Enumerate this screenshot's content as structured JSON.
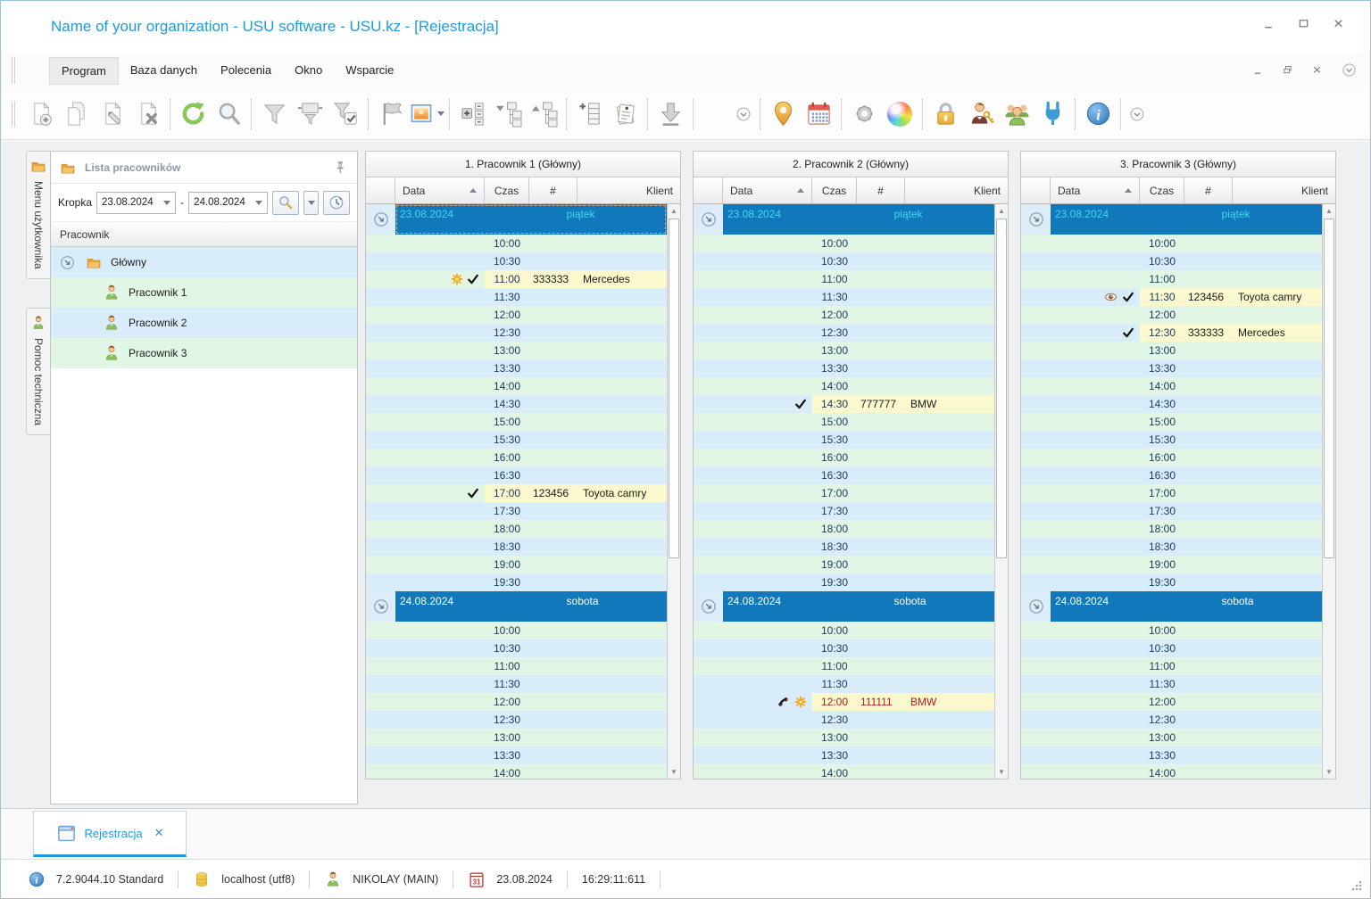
{
  "window": {
    "title": "Name of your organization - USU software - USU.kz - [Rejestracja]",
    "controls": [
      "minimize",
      "maximize",
      "close"
    ]
  },
  "menu": {
    "items": [
      "Program",
      "Baza danych",
      "Polecenia",
      "Okno",
      "Wsparcie"
    ],
    "active": "Program",
    "right_controls": [
      "minimize",
      "restore",
      "close",
      "collapse-ribbon"
    ]
  },
  "toolbar": {
    "groups": [
      {
        "items": [
          "doc-new-icon",
          "doc-copy-icon",
          "doc-edit-icon",
          "doc-delete-icon"
        ]
      },
      {
        "items": [
          "refresh-icon",
          "search-icon"
        ]
      },
      {
        "items": [
          "filter-icon",
          "filter-panel-icon",
          "filter-check-icon"
        ]
      },
      {
        "items": [
          "flag-icon",
          "image-icon"
        ]
      },
      {
        "items": [
          "expand-all-icon",
          "tree-collapse-icon",
          "tree-expand-icon"
        ]
      },
      {
        "items": [
          "table-add-icon",
          "notes-icon"
        ]
      },
      {
        "items": [
          "download-icon"
        ]
      },
      {
        "items": [
          "overflow-icon"
        ],
        "small": true,
        "gap": 38
      },
      {
        "items": [
          "location-icon",
          "calendar-icon"
        ]
      },
      {
        "items": [
          "gear-icon",
          "colors-icon"
        ]
      },
      {
        "items": [
          "lock-icon",
          "user-key-icon",
          "users-icon",
          "plug-icon"
        ]
      },
      {
        "items": [
          "info-icon"
        ]
      },
      {
        "items": [
          "overflow-icon"
        ],
        "small": true,
        "nosep": true
      }
    ]
  },
  "sidebar": {
    "tabs": [
      {
        "label": "Menu użytkownika",
        "icon": "folder-open-icon"
      },
      {
        "label": "Pomoc techniczna",
        "icon": "employee-icon"
      }
    ],
    "panel_title": "Lista pracowników",
    "panel_icons": [
      "folder-open-icon",
      "pin-icon"
    ],
    "filter": {
      "label": "Kropka",
      "date_from": "23.08.2024",
      "date_to": "24.08.2024",
      "dash": "-",
      "buttons": [
        "magnifier-gold-icon",
        "dropdown-caret",
        "clock-icon"
      ]
    },
    "tree_header": "Pracownik",
    "tree": {
      "root": {
        "label": "Główny",
        "icons": [
          "expand-arrow-icon",
          "folder-open-icon"
        ]
      },
      "children": [
        {
          "label": "Pracownik 1",
          "icon": "employee-icon"
        },
        {
          "label": "Pracownik 2",
          "icon": "employee-icon"
        },
        {
          "label": "Pracownik 3",
          "icon": "employee-icon"
        }
      ]
    }
  },
  "calendar": {
    "headers": {
      "data": "Data",
      "czas": "Czas",
      "num": "#",
      "klient": "Klient"
    },
    "columns": [
      {
        "title": "1. Pracownik 1 (Główny)",
        "days": [
          {
            "date": "23.08.2024",
            "weekday": "piątek",
            "highlight": true,
            "focused": true,
            "times": [
              "10:00",
              "10:30",
              "11:00",
              "11:30",
              "12:00",
              "12:30",
              "13:00",
              "13:30",
              "14:00",
              "14:30",
              "15:00",
              "15:30",
              "16:00",
              "16:30",
              "17:00",
              "17:30",
              "18:00",
              "18:30",
              "19:00",
              "19:30"
            ],
            "appointments": [
              {
                "time": "11:00",
                "num": "333333",
                "client": "Mercedes",
                "icons": [
                  "asterisk-icon",
                  "check-icon"
                ]
              },
              {
                "time": "17:00",
                "num": "123456",
                "client": "Toyota camry",
                "icons": [
                  "check-icon"
                ]
              }
            ]
          },
          {
            "date": "24.08.2024",
            "weekday": "sobota",
            "times": [
              "10:00",
              "10:30",
              "11:00",
              "11:30",
              "12:00",
              "12:30",
              "13:00",
              "13:30",
              "14:00"
            ],
            "appointments": []
          }
        ]
      },
      {
        "title": "2. Pracownik 2 (Główny)",
        "days": [
          {
            "date": "23.08.2024",
            "weekday": "piątek",
            "highlight": true,
            "times": [
              "10:00",
              "10:30",
              "11:00",
              "11:30",
              "12:00",
              "12:30",
              "13:00",
              "13:30",
              "14:00",
              "14:30",
              "15:00",
              "15:30",
              "16:00",
              "16:30",
              "17:00",
              "17:30",
              "18:00",
              "18:30",
              "19:00",
              "19:30"
            ],
            "appointments": [
              {
                "time": "14:30",
                "num": "777777",
                "client": "BMW",
                "icons": [
                  "check-icon"
                ]
              }
            ]
          },
          {
            "date": "24.08.2024",
            "weekday": "sobota",
            "times": [
              "10:00",
              "10:30",
              "11:00",
              "11:30",
              "12:00",
              "12:30",
              "13:00",
              "13:30",
              "14:00"
            ],
            "appointments": [
              {
                "time": "12:00",
                "num": "111111",
                "client": "BMW",
                "icons": [
                  "phone-icon",
                  "asterisk-icon"
                ],
                "color": "red",
                "tint": "blue"
              }
            ]
          }
        ]
      },
      {
        "title": "3. Pracownik 3 (Główny)",
        "days": [
          {
            "date": "23.08.2024",
            "weekday": "piątek",
            "highlight": true,
            "times": [
              "10:00",
              "10:30",
              "11:00",
              "11:30",
              "12:00",
              "12:30",
              "13:00",
              "13:30",
              "14:00",
              "14:30",
              "15:00",
              "15:30",
              "16:00",
              "16:30",
              "17:00",
              "17:30",
              "18:00",
              "18:30",
              "19:00",
              "19:30"
            ],
            "appointments": [
              {
                "time": "11:30",
                "num": "123456",
                "client": "Toyota camry",
                "icons": [
                  "eye-icon",
                  "check-icon"
                ]
              },
              {
                "time": "12:30",
                "num": "333333",
                "client": "Mercedes",
                "icons": [
                  "check-icon"
                ]
              }
            ]
          },
          {
            "date": "24.08.2024",
            "weekday": "sobota",
            "times": [
              "10:00",
              "10:30",
              "11:00",
              "11:30",
              "12:00",
              "12:30",
              "13:00",
              "13:30",
              "14:00"
            ],
            "appointments": []
          }
        ]
      }
    ]
  },
  "tabbar": {
    "tabs": [
      {
        "label": "Rejestracja",
        "icon": "window-icon",
        "close": "✕",
        "active": true
      }
    ]
  },
  "statusbar": {
    "items": [
      {
        "icon": "info-icon",
        "text": "7.2.9044.10 Standard"
      },
      {
        "icon": "database-icon",
        "text": "localhost (utf8)"
      },
      {
        "icon": "employee-icon",
        "text": "NIKOLAY (MAIN)"
      },
      {
        "icon": "calendar31-icon",
        "text": "23.08.2024"
      },
      {
        "icon": null,
        "text": "16:29:11:611"
      }
    ]
  },
  "colors": {
    "accent": "#1e9ade",
    "banner_blue": "#1179bb",
    "banner_selected_text": "#3fd9ef",
    "row_green": "#e2f6e5",
    "row_blue": "#d9ecfa",
    "appointment_yellow": "#fbf8cd",
    "alert_red": "#b02020"
  }
}
